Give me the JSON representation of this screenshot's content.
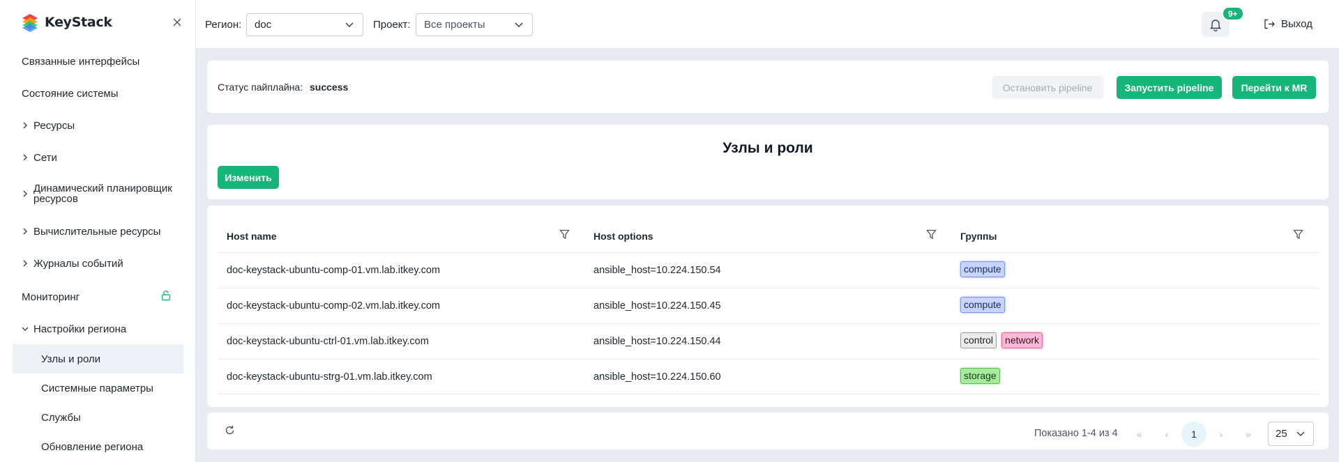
{
  "app": {
    "name": "KeyStack"
  },
  "sidebar": {
    "items": [
      {
        "label": "Связанные интерфейсы"
      },
      {
        "label": "Состояние системы"
      },
      {
        "label": "Ресурсы"
      },
      {
        "label": "Сети"
      },
      {
        "label": "Динамический планировщик ресурсов"
      },
      {
        "label": "Вычислительные ресурсы"
      },
      {
        "label": "Журналы событий"
      },
      {
        "label": "Мониторинг"
      },
      {
        "label": "Настройки региона"
      }
    ],
    "subitems": [
      {
        "label": "Узлы и роли"
      },
      {
        "label": "Системные параметры"
      },
      {
        "label": "Службы"
      },
      {
        "label": "Обновление региона"
      }
    ]
  },
  "header": {
    "region_label": "Регион:",
    "region_value": "doc",
    "project_label": "Проект:",
    "project_value": "Все проекты",
    "notifications_badge": "9+",
    "logout_label": "Выход"
  },
  "pipeline": {
    "status_label": "Статус пайплайна:",
    "status_value": "success",
    "stop_label": "Остановить pipeline",
    "run_label": "Запустить pipeline",
    "mr_label": "Перейти к MR"
  },
  "section": {
    "title": "Узлы и роли",
    "edit_label": "Изменить"
  },
  "table": {
    "headers": [
      "Host name",
      "Host options",
      "Группы"
    ],
    "rows": [
      {
        "host": "doc-keystack-ubuntu-comp-01.vm.lab.itkey.com",
        "options": "ansible_host=10.224.150.54",
        "groups": [
          "compute"
        ]
      },
      {
        "host": "doc-keystack-ubuntu-comp-02.vm.lab.itkey.com",
        "options": "ansible_host=10.224.150.45",
        "groups": [
          "compute"
        ]
      },
      {
        "host": "doc-keystack-ubuntu-ctrl-01.vm.lab.itkey.com",
        "options": "ansible_host=10.224.150.44",
        "groups": [
          "control",
          "network"
        ]
      },
      {
        "host": "doc-keystack-ubuntu-strg-01.vm.lab.itkey.com",
        "options": "ansible_host=10.224.150.60",
        "groups": [
          "storage"
        ]
      }
    ]
  },
  "pager": {
    "summary": "Показано 1-4 из 4",
    "first": "«",
    "prev": "‹",
    "current": "1",
    "next": "›",
    "last": "»",
    "per_page": "25"
  },
  "colors": {
    "accent": "#16b67a",
    "compute": "#c7d4ff",
    "control": "#ececec",
    "network": "#ffb8d6",
    "storage": "#a8eba0"
  }
}
